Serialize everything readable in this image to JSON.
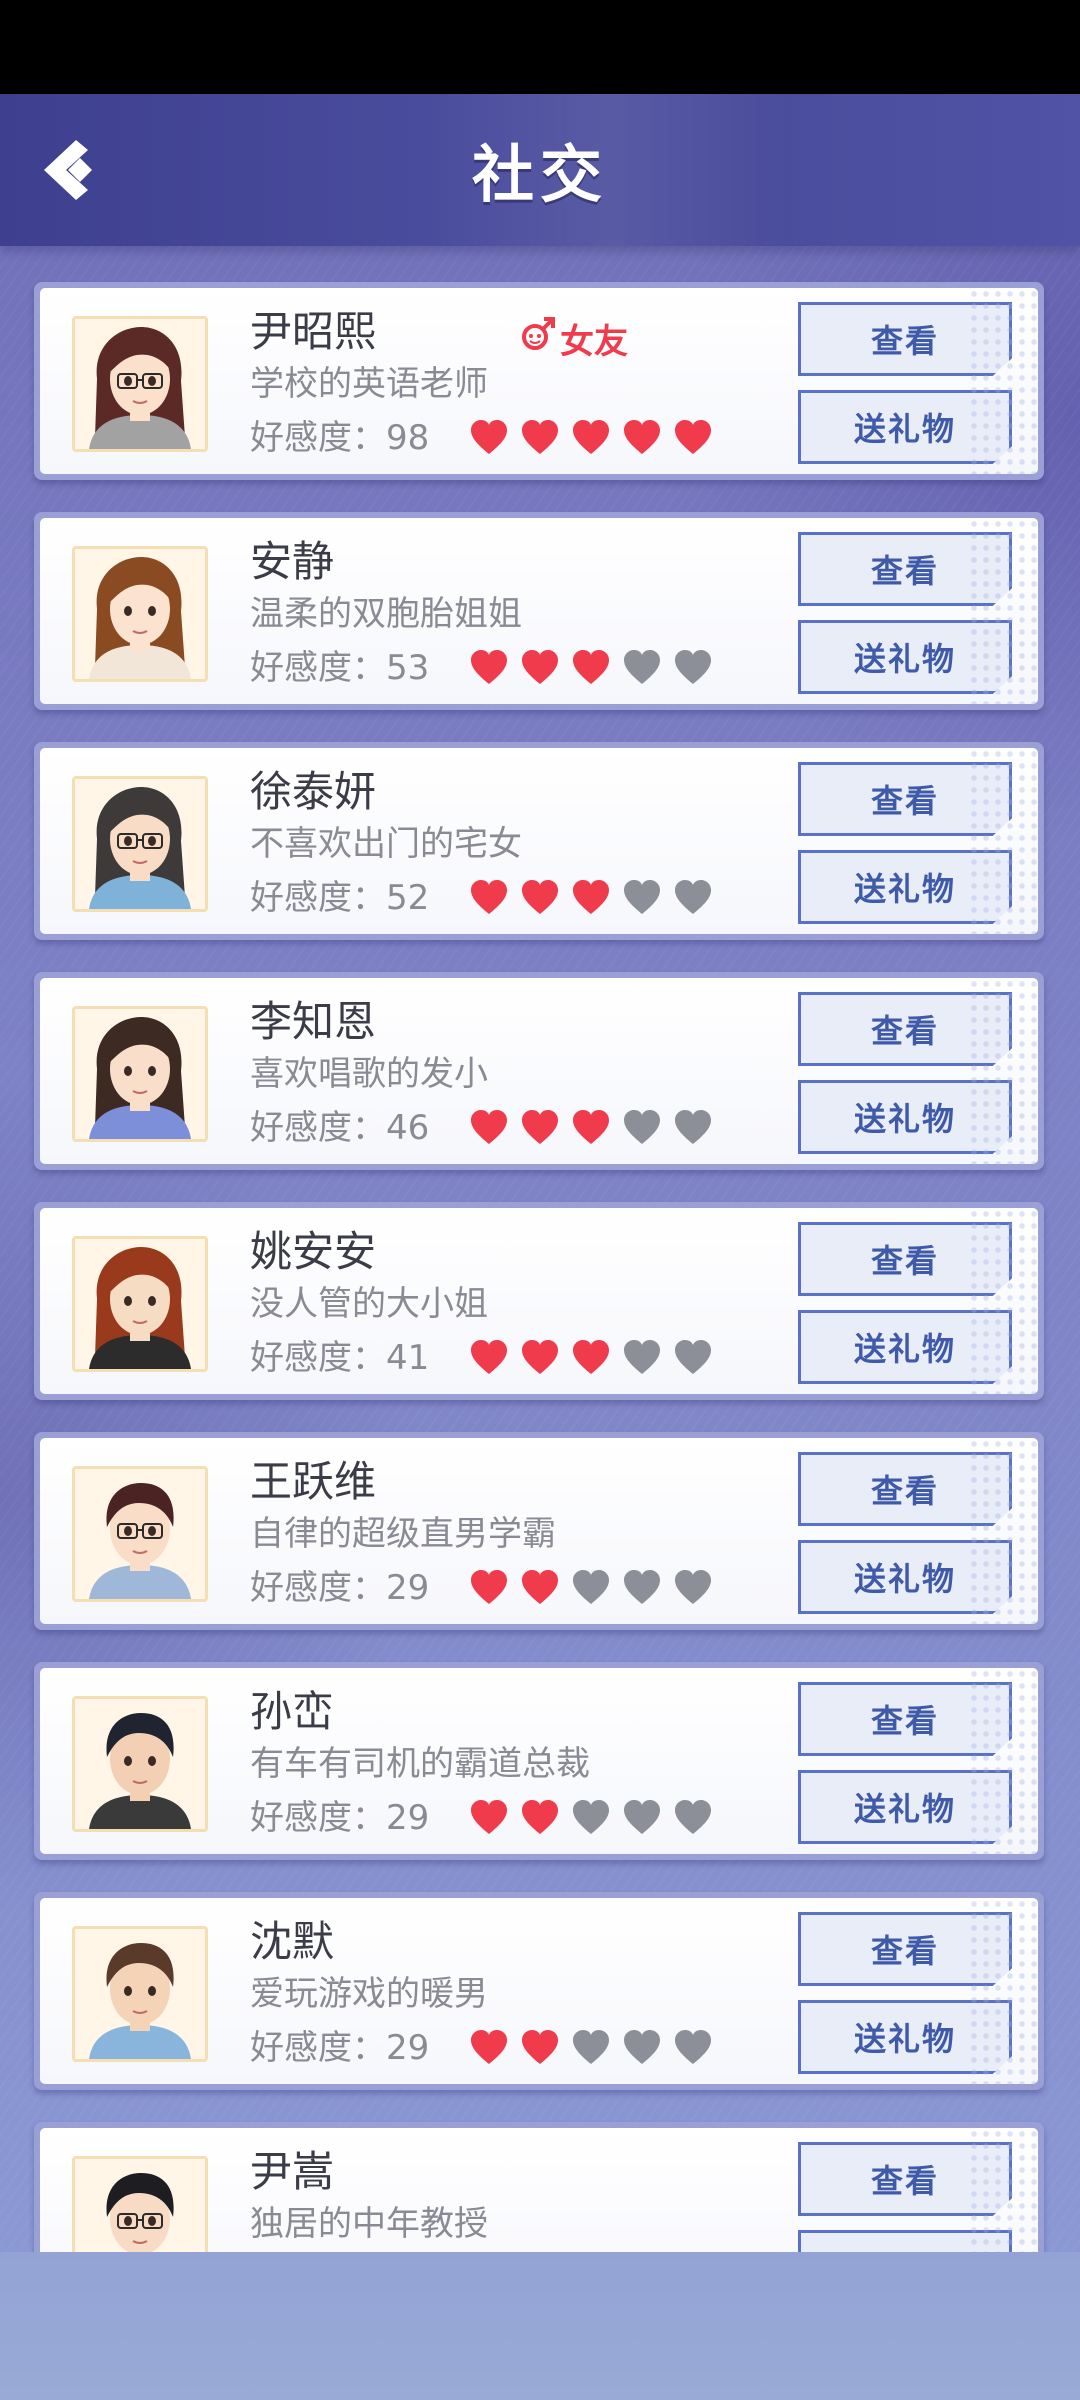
{
  "header": {
    "title": "社交",
    "back_icon": "back-chevron-icon"
  },
  "labels": {
    "view": "查看",
    "gift": "送礼物"
  },
  "colors": {
    "heart_active": "#ef3b4c",
    "heart_inactive": "#8d8f98",
    "tag": "#ef3b4c",
    "button_text": "#3f5aa8",
    "button_border": "#5a72c6"
  },
  "characters": [
    {
      "name": "尹昭熙",
      "tag": "女友",
      "desc": "学校的英语老师",
      "affection": "好感度：98",
      "hearts_filled": 5,
      "hearts_total": 5,
      "gender": "female"
    },
    {
      "name": "安静",
      "desc": "温柔的双胞胎姐姐",
      "affection": "好感度：53",
      "hearts_filled": 3,
      "hearts_total": 5,
      "gender": "female"
    },
    {
      "name": "徐泰妍",
      "desc": "不喜欢出门的宅女",
      "affection": "好感度：52",
      "hearts_filled": 3,
      "hearts_total": 5,
      "gender": "female"
    },
    {
      "name": "李知恩",
      "desc": "喜欢唱歌的发小",
      "affection": "好感度：46",
      "hearts_filled": 3,
      "hearts_total": 5,
      "gender": "female"
    },
    {
      "name": "姚安安",
      "desc": "没人管的大小姐",
      "affection": "好感度：41",
      "hearts_filled": 3,
      "hearts_total": 5,
      "gender": "female"
    },
    {
      "name": "王跃维",
      "desc": "自律的超级直男学霸",
      "affection": "好感度：29",
      "hearts_filled": 2,
      "hearts_total": 5,
      "gender": "male"
    },
    {
      "name": "孙峦",
      "desc": "有车有司机的霸道总裁",
      "affection": "好感度：29",
      "hearts_filled": 2,
      "hearts_total": 5,
      "gender": "male"
    },
    {
      "name": "沈默",
      "desc": "爱玩游戏的暖男",
      "affection": "好感度：29",
      "hearts_filled": 2,
      "hearts_total": 5,
      "gender": "male"
    },
    {
      "name": "尹嵩",
      "desc": "独居的中年教授",
      "gender": "male"
    }
  ]
}
